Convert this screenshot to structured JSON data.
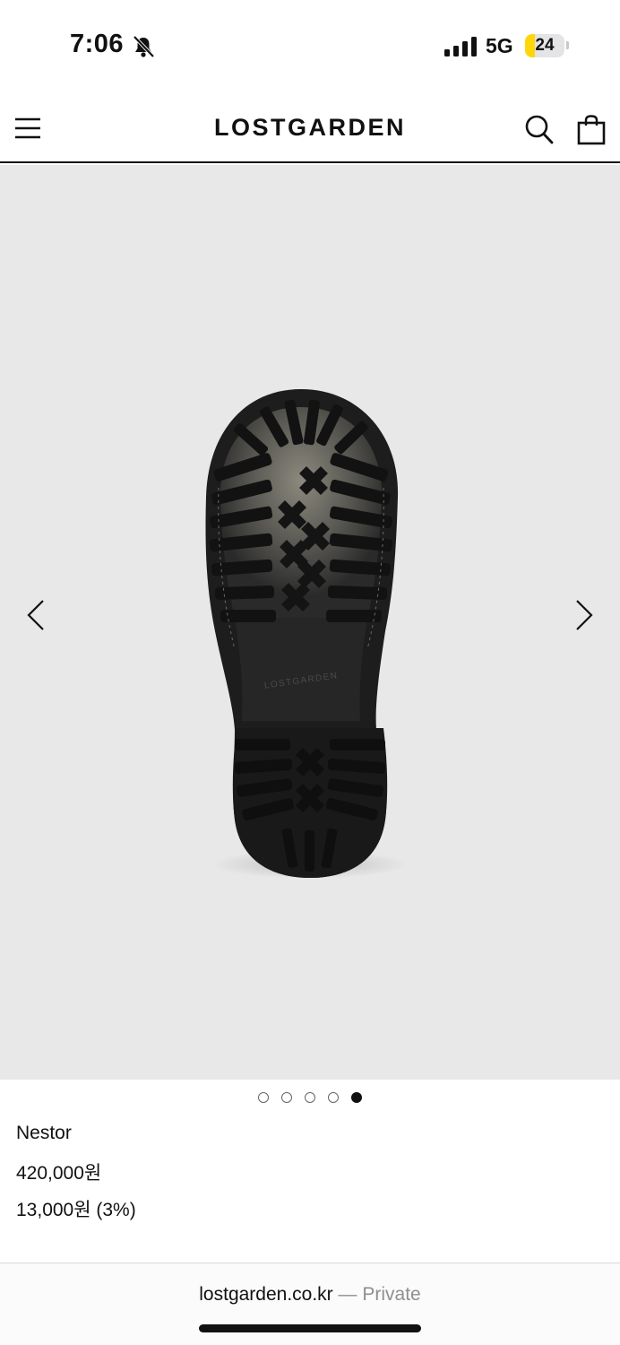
{
  "status_bar": {
    "time": "7:06",
    "network": "5G",
    "battery_percent": 24,
    "battery_label": "24",
    "battery_color": "#ffd60a"
  },
  "header": {
    "logo": "LOSTGARDEN",
    "icons": [
      "menu-icon",
      "search-icon",
      "shopping-bag-icon"
    ]
  },
  "gallery": {
    "image_alt": "Shoe sole",
    "sole_brand_mark": "LOSTGARDEN",
    "slide_count": 5,
    "active_slide": 5
  },
  "product": {
    "name": "Nestor",
    "price": "420,000원",
    "points": "13,000원 (3%)"
  },
  "browser": {
    "domain": "lostgarden.co.kr",
    "separator": " — Private"
  }
}
